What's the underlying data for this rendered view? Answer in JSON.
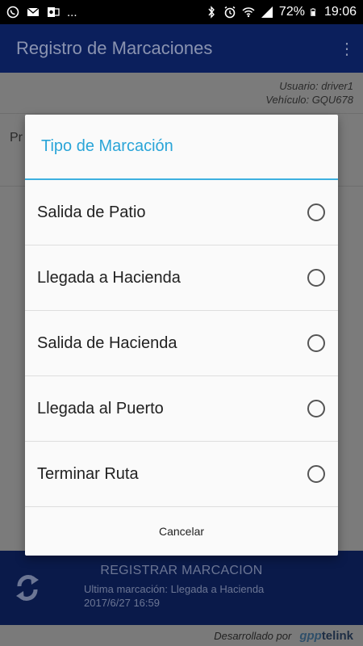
{
  "status_bar": {
    "battery": "72%",
    "time": "19:06",
    "more": "...",
    "icons": [
      "whatsapp-icon",
      "mail-icon",
      "outlook-icon",
      "bluetooth-icon",
      "alarm-icon",
      "wifi-icon",
      "signal-icon",
      "battery-icon"
    ]
  },
  "app_bar": {
    "title": "Registro de Marcaciones",
    "menu": "⋮"
  },
  "user_info": {
    "user": "Usuario: driver1",
    "vehicle": "Vehículo: GQU678"
  },
  "background": {
    "label_fragment": "Pr"
  },
  "dialog": {
    "title": "Tipo de Marcación",
    "options": [
      {
        "label": "Salida de Patio",
        "selected": false
      },
      {
        "label": "Llegada a Hacienda",
        "selected": false
      },
      {
        "label": "Salida de Hacienda",
        "selected": false
      },
      {
        "label": "Llegada al Puerto",
        "selected": false
      },
      {
        "label": "Terminar Ruta",
        "selected": false
      }
    ],
    "cancel_label": "Cancelar"
  },
  "register": {
    "title": "REGISTRAR MARCACION",
    "last": "Ultima marcación: Llegada a Hacienda",
    "date": "2017/6/27 16:59"
  },
  "footer": {
    "developed_by": "Desarrollado por",
    "logo_gpp": "gpp",
    "logo_telink": "telink"
  },
  "colors": {
    "accent": "#2aa5d8",
    "app_bar": "#0b1f5c",
    "register_bg": "#0a1a4a"
  }
}
